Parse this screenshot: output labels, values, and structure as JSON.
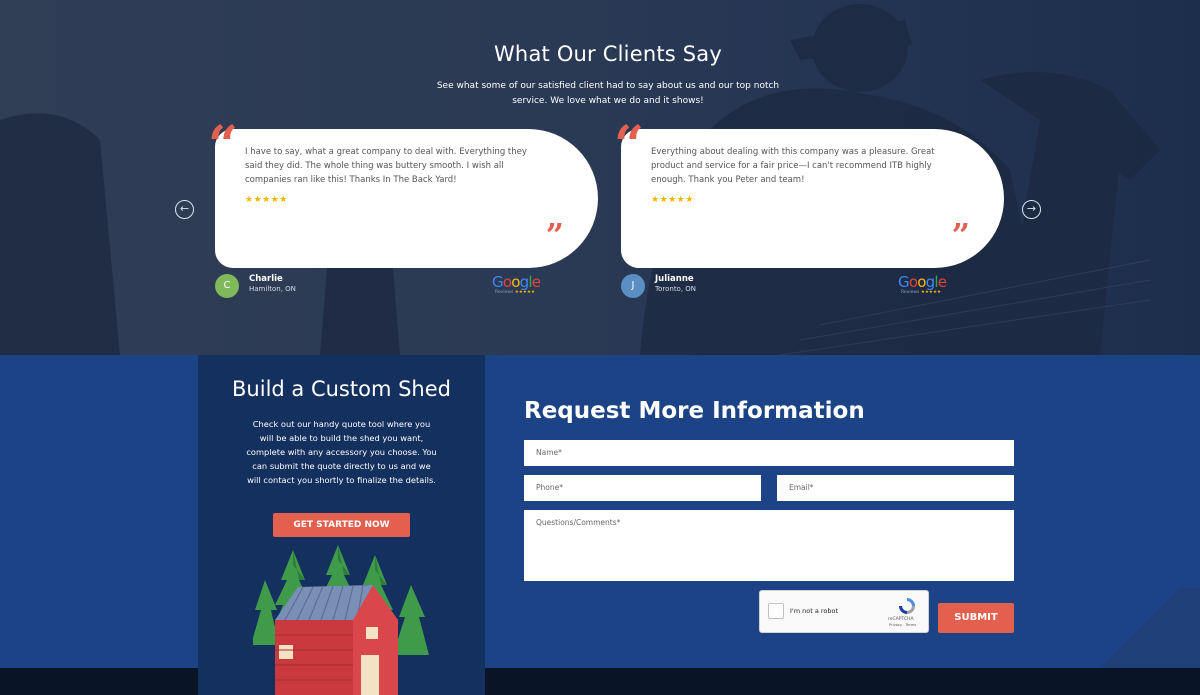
{
  "testimonials": {
    "title": "What Our Clients Say",
    "subtitle": "See what some of our satisfied client had to say about us and our top notch service. We love what we do and it shows!",
    "prev_icon": "arrow-left-circle-icon",
    "next_icon": "arrow-right-circle-icon",
    "reviews": [
      {
        "text": "I have to say, what a great company to deal with. Everything they said they did. The whole thing was buttery smooth. I wish all companies ran like this! Thanks In The Back Yard!",
        "stars": "★★★★★",
        "author_initial": "C",
        "author_name": "Charlie",
        "author_location": "Hamilton, ON",
        "avatar_color": "#7fb95a",
        "source_word": "Google",
        "source_sub": "Reviews"
      },
      {
        "text": "Everything about dealing with this company was a pleasure. Great product and service for a fair price—I can't recommend ITB highly enough. Thank you Peter and team!",
        "stars": "★★★★★",
        "author_initial": "J",
        "author_name": "Julianne",
        "author_location": "Toronto, ON",
        "avatar_color": "#5b8ec2",
        "source_word": "Google",
        "source_sub": "Reviews"
      }
    ],
    "source_stars": "★★★★★"
  },
  "shed": {
    "title": "Build a Custom Shed",
    "text": "Check out our handy quote tool where you will be able to build the shed you want, complete with any accessory you choose. You can submit the quote directly to us and we will contact you shortly to finalize the details.",
    "cta_label": "GET STARTED NOW"
  },
  "form": {
    "title": "Request More Information",
    "name_placeholder": "Name*",
    "phone_placeholder": "Phone*",
    "email_placeholder": "Email*",
    "comments_placeholder": "Questions/Comments*",
    "recaptcha_label": "I'm not a robot",
    "recaptcha_brand": "reCAPTCHA",
    "recaptcha_links": "Privacy - Terms",
    "submit_label": "SUBMIT"
  },
  "colors": {
    "accent": "#e2604d",
    "form_background": "#1b4385",
    "shed_panel": "#14305e",
    "testimonial_background": "#2d3b54",
    "star": "#f5b400"
  }
}
